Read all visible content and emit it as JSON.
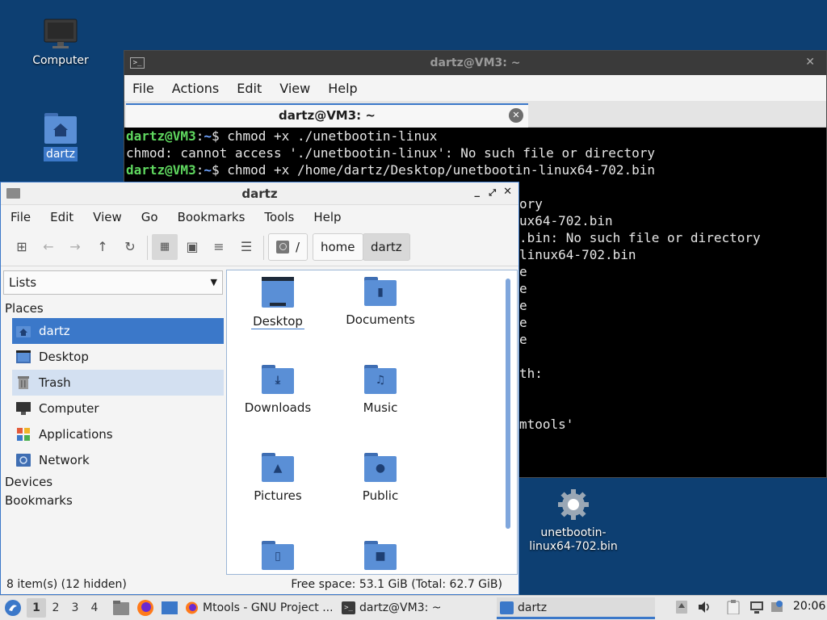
{
  "desktop": {
    "icons": [
      {
        "label": "Computer"
      },
      {
        "label": "dartz"
      }
    ],
    "file_icon": {
      "label": "unetbootin-linux64-702.bin"
    }
  },
  "terminal": {
    "title": "dartz@VM3: ~",
    "menu": [
      "File",
      "Actions",
      "Edit",
      "View",
      "Help"
    ],
    "tab_title": "dartz@VM3: ~",
    "lines": [
      {
        "user": "dartz@VM3",
        "sep": ":",
        "path": "~",
        "cmd": "$ chmod +x ./unetbootin-linux"
      },
      {
        "text": "chmod: cannot access './unetbootin-linux': No such file or directory"
      },
      {
        "user": "dartz@VM3",
        "sep": ":",
        "path": "~",
        "cmd": "$ chmod +x /home/dartz/Desktop/unetbootin-linux64-702.bin"
      }
    ],
    "partial_lines": [
      "ory",
      "ux64-702.bin",
      ".bin: No such file or directory",
      "linux64-702.bin",
      "e",
      "e",
      "e",
      "e",
      "e",
      "",
      "th:",
      "",
      "",
      "mtools'"
    ]
  },
  "filemanager": {
    "title": "dartz",
    "menu": [
      "File",
      "Edit",
      "View",
      "Go",
      "Bookmarks",
      "Tools",
      "Help"
    ],
    "breadcrumbs": [
      "/",
      "home",
      "dartz"
    ],
    "side_selector": "Lists",
    "sections": {
      "places": "Places",
      "devices": "Devices",
      "bookmarks": "Bookmarks"
    },
    "places": [
      {
        "label": "dartz",
        "icon": "home-icon"
      },
      {
        "label": "Desktop",
        "icon": "desktop-icon"
      },
      {
        "label": "Trash",
        "icon": "trash-icon"
      },
      {
        "label": "Computer",
        "icon": "computer-icon"
      },
      {
        "label": "Applications",
        "icon": "applications-icon"
      },
      {
        "label": "Network",
        "icon": "network-icon"
      }
    ],
    "folders": [
      {
        "label": "Desktop",
        "icon": "desktop-folder-icon"
      },
      {
        "label": "Documents",
        "icon": "documents-folder-icon"
      },
      {
        "label": "Downloads",
        "icon": "downloads-folder-icon"
      },
      {
        "label": "Music",
        "icon": "music-folder-icon"
      },
      {
        "label": "Pictures",
        "icon": "pictures-folder-icon"
      },
      {
        "label": "Public",
        "icon": "public-folder-icon"
      },
      {
        "label": "",
        "icon": "templates-folder-icon"
      },
      {
        "label": "",
        "icon": "videos-folder-icon"
      }
    ],
    "status_left": "8 item(s) (12 hidden)",
    "status_right": "Free space: 53.1 GiB (Total: 62.7 GiB)"
  },
  "taskbar": {
    "workspaces": [
      "1",
      "2",
      "3",
      "4"
    ],
    "tasks": [
      {
        "label": "Mtools - GNU Project ..."
      },
      {
        "label": "dartz@VM3: ~"
      },
      {
        "label": "dartz"
      }
    ],
    "clock": "20:06"
  },
  "colors": {
    "accent": "#3b78c9",
    "desktop": "#0d3f72",
    "prompt_user": "#5fd75f",
    "prompt_path": "#6fa3ff"
  }
}
